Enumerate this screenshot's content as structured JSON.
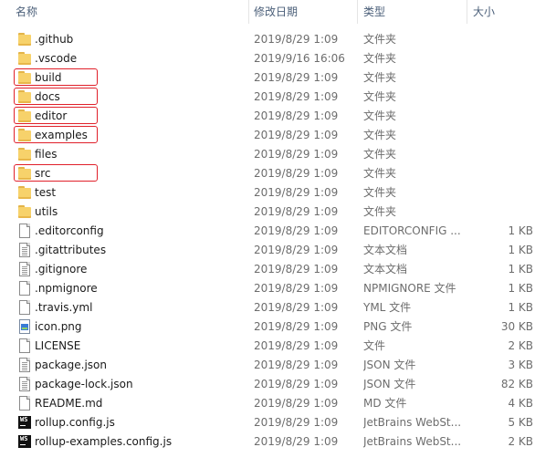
{
  "header": {
    "name_label": "名称",
    "date_label": "修改日期",
    "type_label": "类型",
    "size_label": "大小"
  },
  "files": [
    {
      "name": ".github",
      "date": "2019/8/29 1:09",
      "type": "文件夹",
      "size": "",
      "icon": "folder-icon",
      "highlighted": false
    },
    {
      "name": ".vscode",
      "date": "2019/9/16 16:06",
      "type": "文件夹",
      "size": "",
      "icon": "folder-icon",
      "highlighted": false
    },
    {
      "name": "build",
      "date": "2019/8/29 1:09",
      "type": "文件夹",
      "size": "",
      "icon": "folder-icon",
      "highlighted": true
    },
    {
      "name": "docs",
      "date": "2019/8/29 1:09",
      "type": "文件夹",
      "size": "",
      "icon": "folder-icon",
      "highlighted": true
    },
    {
      "name": "editor",
      "date": "2019/8/29 1:09",
      "type": "文件夹",
      "size": "",
      "icon": "folder-icon",
      "highlighted": true
    },
    {
      "name": "examples",
      "date": "2019/8/29 1:09",
      "type": "文件夹",
      "size": "",
      "icon": "folder-icon",
      "highlighted": true
    },
    {
      "name": "files",
      "date": "2019/8/29 1:09",
      "type": "文件夹",
      "size": "",
      "icon": "folder-icon",
      "highlighted": false
    },
    {
      "name": "src",
      "date": "2019/8/29 1:09",
      "type": "文件夹",
      "size": "",
      "icon": "folder-icon",
      "highlighted": true
    },
    {
      "name": "test",
      "date": "2019/8/29 1:09",
      "type": "文件夹",
      "size": "",
      "icon": "folder-icon",
      "highlighted": false
    },
    {
      "name": "utils",
      "date": "2019/8/29 1:09",
      "type": "文件夹",
      "size": "",
      "icon": "folder-icon",
      "highlighted": false
    },
    {
      "name": ".editorconfig",
      "date": "2019/8/29 1:09",
      "type": "EDITORCONFIG ...",
      "size": "1 KB",
      "icon": "file-icon",
      "highlighted": false
    },
    {
      "name": ".gitattributes",
      "date": "2019/8/29 1:09",
      "type": "文本文档",
      "size": "1 KB",
      "icon": "text-file-icon",
      "highlighted": false
    },
    {
      "name": ".gitignore",
      "date": "2019/8/29 1:09",
      "type": "文本文档",
      "size": "1 KB",
      "icon": "text-file-icon",
      "highlighted": false
    },
    {
      "name": ".npmignore",
      "date": "2019/8/29 1:09",
      "type": "NPMIGNORE 文件",
      "size": "1 KB",
      "icon": "file-icon",
      "highlighted": false
    },
    {
      "name": ".travis.yml",
      "date": "2019/8/29 1:09",
      "type": "YML 文件",
      "size": "1 KB",
      "icon": "file-icon",
      "highlighted": false
    },
    {
      "name": "icon.png",
      "date": "2019/8/29 1:09",
      "type": "PNG 文件",
      "size": "30 KB",
      "icon": "image-file-icon",
      "highlighted": false
    },
    {
      "name": "LICENSE",
      "date": "2019/8/29 1:09",
      "type": "文件",
      "size": "2 KB",
      "icon": "file-icon",
      "highlighted": false
    },
    {
      "name": "package.json",
      "date": "2019/8/29 1:09",
      "type": "JSON 文件",
      "size": "3 KB",
      "icon": "text-file-icon",
      "highlighted": false
    },
    {
      "name": "package-lock.json",
      "date": "2019/8/29 1:09",
      "type": "JSON 文件",
      "size": "82 KB",
      "icon": "text-file-icon",
      "highlighted": false
    },
    {
      "name": "README.md",
      "date": "2019/8/29 1:09",
      "type": "MD 文件",
      "size": "4 KB",
      "icon": "file-icon",
      "highlighted": false
    },
    {
      "name": "rollup.config.js",
      "date": "2019/8/29 1:09",
      "type": "JetBrains WebSt...",
      "size": "5 KB",
      "icon": "webstorm-file-icon",
      "highlighted": false
    },
    {
      "name": "rollup-examples.config.js",
      "date": "2019/8/29 1:09",
      "type": "JetBrains WebSt...",
      "size": "2 KB",
      "icon": "webstorm-file-icon",
      "highlighted": false
    }
  ],
  "colors": {
    "highlight_border": "#e0202a",
    "folder": "#f7d26b",
    "header_text": "#4c607a"
  }
}
